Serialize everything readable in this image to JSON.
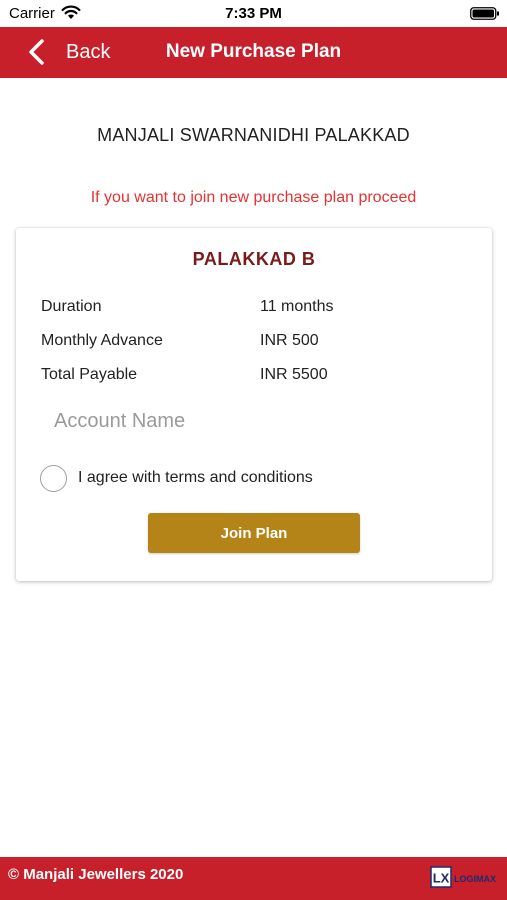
{
  "status_bar": {
    "carrier": "Carrier",
    "time": "7:33 PM"
  },
  "nav": {
    "back_label": "Back",
    "title": "New Purchase Plan",
    "color": "#c8202b"
  },
  "shop_name": "MANJALI SWARNANIDHI PALAKKAD",
  "info_text": "If you want to join new purchase plan proceed",
  "plan": {
    "name": "PALAKKAD B",
    "details": [
      {
        "label": "Duration",
        "value": "11 months"
      },
      {
        "label": "Monthly Advance",
        "value": "INR 500"
      },
      {
        "label": "Total Payable",
        "value": "INR 5500"
      }
    ]
  },
  "form": {
    "account_name_placeholder": "Account Name",
    "account_name_value": "",
    "agree_label": "I agree with terms and conditions",
    "agree_checked": false,
    "join_button_label": "Join Plan",
    "join_button_color": "#b48418"
  },
  "footer": {
    "copyright": "© Manjali Jewellers 2020",
    "logo_text": "LX",
    "logo_brand": "LOGIMAX"
  }
}
